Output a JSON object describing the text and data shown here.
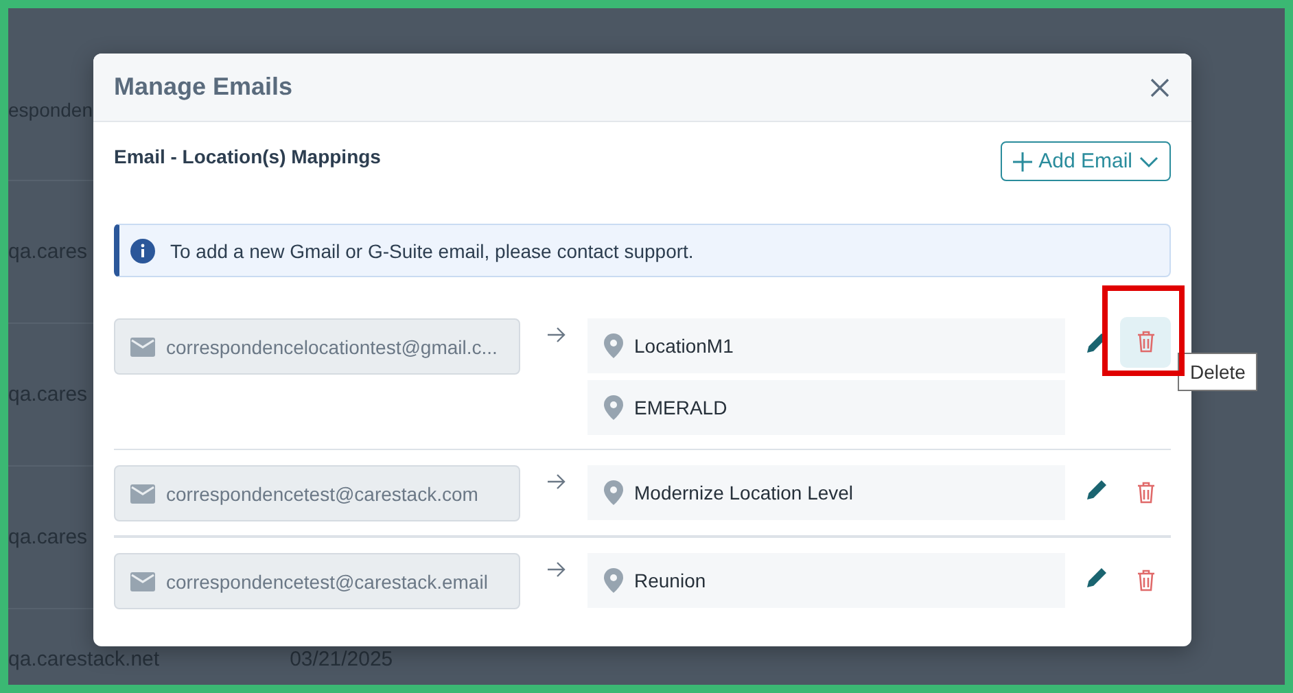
{
  "background_page": {
    "rows": [
      {
        "column_1": "esponden"
      },
      {
        "column_1": "qa.cares"
      },
      {
        "column_1": "qa.cares"
      },
      {
        "column_1": "qa.cares"
      },
      {
        "column_1": "qa.carestack.net",
        "column_2": "03/21/2025"
      }
    ]
  },
  "dialog": {
    "title": "Manage Emails",
    "subtitle": "Email - Location(s) Mappings",
    "add_button": "Add Email",
    "info": "To add a new Gmail or G-Suite email, please contact support.",
    "mappings": [
      {
        "email": "correspondencelocationtest@gmail.c...",
        "locations": [
          "LocationM1",
          "EMERALD"
        ],
        "delete_hovered": true,
        "delete_tooltip": "Delete",
        "highlighted": true
      },
      {
        "email": "correspondencetest@carestack.com",
        "locations": [
          "Modernize Location Level"
        ],
        "delete_hovered": false,
        "highlighted": false
      },
      {
        "email": "correspondencetest@carestack.email",
        "locations": [
          "Reunion"
        ],
        "delete_hovered": false,
        "highlighted": false
      }
    ]
  }
}
